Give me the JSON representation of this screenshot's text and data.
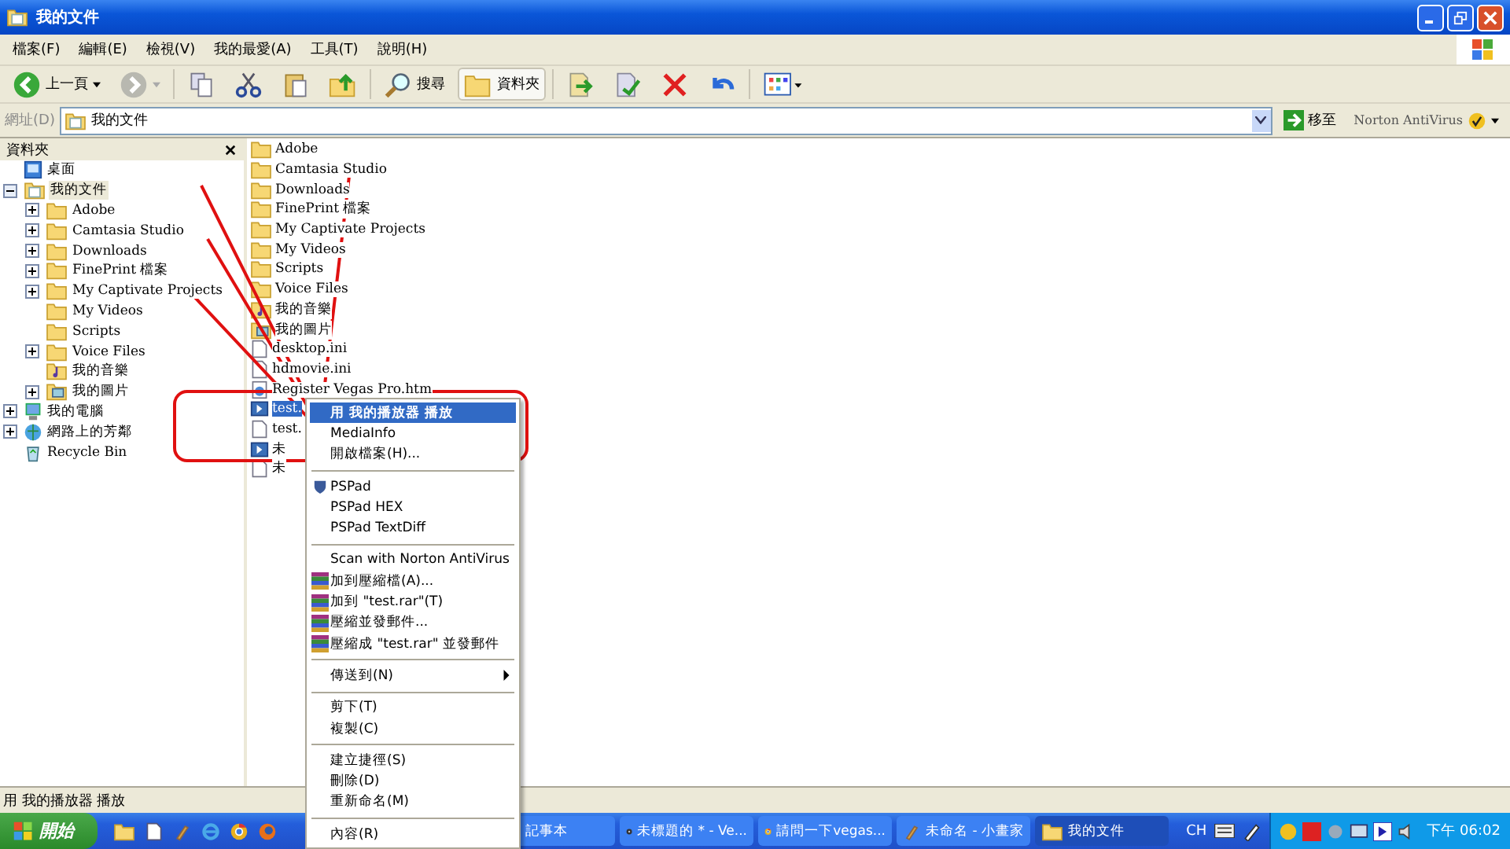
{
  "window": {
    "title": "我的文件"
  },
  "menu_bar": [
    "檔案(F)",
    "編輯(E)",
    "檢視(V)",
    "我的最愛(A)",
    "工具(T)",
    "說明(H)"
  ],
  "toolbar": [
    {
      "kind": "back",
      "label": "上一頁",
      "selected": false
    },
    {
      "kind": "forward",
      "selected": false
    },
    {
      "kind": "sep"
    },
    {
      "kind": "copy",
      "selected": false
    },
    {
      "kind": "cut",
      "selected": false
    },
    {
      "kind": "paste",
      "selected": false
    },
    {
      "kind": "up",
      "selected": false
    },
    {
      "kind": "sep"
    },
    {
      "kind": "search",
      "label": "搜尋",
      "selected": false
    },
    {
      "kind": "folders",
      "label": "資料夾",
      "selected": true
    },
    {
      "kind": "sep"
    },
    {
      "kind": "moveto",
      "selected": false
    },
    {
      "kind": "copyto",
      "selected": false
    },
    {
      "kind": "delete",
      "selected": false
    },
    {
      "kind": "undo",
      "selected": false
    },
    {
      "kind": "sep"
    },
    {
      "kind": "views",
      "selected": false
    }
  ],
  "address_bar": {
    "label": "網址(D)",
    "value": "我的文件",
    "go": "移至",
    "norton": "Norton AntiVirus"
  },
  "folders_pane": {
    "title": "資料夾",
    "items": [
      {
        "label": "桌面",
        "kind": "desktop",
        "selected": false
      },
      {
        "label": "我的文件",
        "kind": "docs",
        "expanded": true,
        "selected": true,
        "children": [
          {
            "label": "Adobe",
            "kind": "folder",
            "expanded": false,
            "selected": false
          },
          {
            "label": "Camtasia Studio",
            "kind": "folder",
            "expanded": false,
            "selected": false
          },
          {
            "label": "Downloads",
            "kind": "folder",
            "expanded": false,
            "selected": false
          },
          {
            "label": "FinePrint 檔案",
            "kind": "folder",
            "expanded": false,
            "selected": false
          },
          {
            "label": "My Captivate Projects",
            "kind": "folder",
            "expanded": false,
            "selected": false
          },
          {
            "label": "My Videos",
            "kind": "folder",
            "selected": false
          },
          {
            "label": "Scripts",
            "kind": "folder",
            "selected": false
          },
          {
            "label": "Voice Files",
            "kind": "folder",
            "expanded": false,
            "selected": false
          },
          {
            "label": "我的音樂",
            "kind": "music",
            "selected": false
          },
          {
            "label": "我的圖片",
            "kind": "pictures",
            "expanded": false,
            "selected": false
          }
        ]
      },
      {
        "label": "我的電腦",
        "kind": "computer",
        "expanded": false,
        "selected": false
      },
      {
        "label": "網路上的芳鄰",
        "kind": "network",
        "expanded": false,
        "selected": false
      },
      {
        "label": "Recycle Bin",
        "kind": "recycle",
        "selected": false
      }
    ]
  },
  "files": [
    {
      "name": "Adobe",
      "kind": "folder",
      "selected": false
    },
    {
      "name": "Camtasia Studio",
      "kind": "folder",
      "selected": false
    },
    {
      "name": "Downloads",
      "kind": "folder",
      "selected": false
    },
    {
      "name": "FinePrint 檔案",
      "kind": "folder",
      "selected": false
    },
    {
      "name": "My Captivate Projects",
      "kind": "folder",
      "selected": false
    },
    {
      "name": "My Videos",
      "kind": "folder",
      "selected": false
    },
    {
      "name": "Scripts",
      "kind": "folder",
      "selected": false
    },
    {
      "name": "Voice Files",
      "kind": "folder",
      "selected": false
    },
    {
      "name": "我的音樂",
      "kind": "music",
      "selected": false
    },
    {
      "name": "我的圖片",
      "kind": "pictures",
      "selected": false
    },
    {
      "name": "desktop.ini",
      "kind": "file",
      "selected": false
    },
    {
      "name": "hdmovie.ini",
      "kind": "file",
      "selected": false
    },
    {
      "name": "Register Vegas Pro.htm",
      "kind": "web",
      "selected": false
    },
    {
      "name": "test.",
      "kind": "media",
      "selected": true
    },
    {
      "name": "test.",
      "kind": "file",
      "selected": false
    },
    {
      "name": "未",
      "kind": "media",
      "selected": false
    },
    {
      "name": "未",
      "kind": "file",
      "selected": false
    }
  ],
  "context_menu": [
    {
      "kind": "plain",
      "label": "用 我的播放器 播放",
      "bold": true,
      "selected": true
    },
    {
      "kind": "plain",
      "label": "MediaInfo",
      "selected": false
    },
    {
      "kind": "plain",
      "label": "開啟檔案(H)...",
      "selected": false
    },
    {
      "kind": "separator"
    },
    {
      "kind": "pspad",
      "label": "PSPad",
      "selected": false
    },
    {
      "kind": "plain",
      "label": "PSPad HEX",
      "selected": false
    },
    {
      "kind": "plain",
      "label": "PSPad TextDiff",
      "selected": false
    },
    {
      "kind": "separator"
    },
    {
      "kind": "plain",
      "label": "Scan with Norton AntiVirus",
      "selected": false
    },
    {
      "kind": "rar",
      "label": "加到壓縮檔(A)...",
      "selected": false
    },
    {
      "kind": "rar",
      "label": "加到 \"test.rar\"(T)",
      "selected": false
    },
    {
      "kind": "rar",
      "label": "壓縮並發郵件...",
      "selected": false
    },
    {
      "kind": "rar",
      "label": "壓縮成 \"test.rar\" 並發郵件",
      "selected": false
    },
    {
      "kind": "separator"
    },
    {
      "kind": "submenu",
      "label": "傳送到(N)",
      "selected": false
    },
    {
      "kind": "separator"
    },
    {
      "kind": "plain",
      "label": "剪下(T)",
      "selected": false
    },
    {
      "kind": "plain",
      "label": "複製(C)",
      "selected": false
    },
    {
      "kind": "separator"
    },
    {
      "kind": "plain",
      "label": "建立捷徑(S)",
      "selected": false
    },
    {
      "kind": "plain",
      "label": "刪除(D)",
      "selected": false
    },
    {
      "kind": "plain",
      "label": "重新命名(M)",
      "selected": false
    },
    {
      "kind": "separator"
    },
    {
      "kind": "plain",
      "label": "內容(R)",
      "selected": false
    }
  ],
  "status_bar": "用 我的播放器 播放",
  "taskbar": {
    "start": "開始",
    "tasks": [
      {
        "label": "記事本",
        "kind": "doc",
        "selected": false
      },
      {
        "label": "未標題的 * - Ve...",
        "kind": "disc",
        "selected": false
      },
      {
        "label": "請問一下vegas...",
        "kind": "chrome",
        "selected": false
      },
      {
        "label": "未命名 - 小畫家",
        "kind": "paint",
        "selected": false
      },
      {
        "label": "我的文件",
        "kind": "folder",
        "selected": true
      }
    ],
    "language": "CH",
    "clock": "下午 06:02"
  }
}
